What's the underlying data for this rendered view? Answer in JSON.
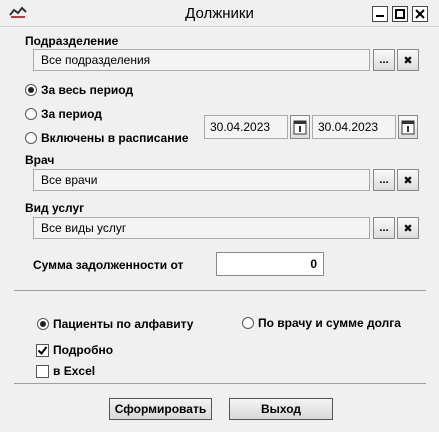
{
  "window": {
    "title": "Должники",
    "icon": "app-icon",
    "controls": [
      "minimize-icon",
      "maximize-icon",
      "close-icon"
    ]
  },
  "department": {
    "label": "Подразделение",
    "value": "Все подразделения",
    "select_label": "...",
    "clear_label": "✖"
  },
  "period": {
    "options": [
      "За весь период",
      "За период",
      "Включены в расписание"
    ],
    "selected": "За весь период",
    "date_from": "30.04.2023",
    "date_to": "30.04.2023",
    "calendar_icon": "calendar-icon"
  },
  "doctor": {
    "label": "Врач",
    "value": "Все врачи",
    "select_label": "...",
    "clear_label": "✖"
  },
  "service_type": {
    "label": "Вид услуг",
    "value": "Все виды услуг",
    "select_label": "...",
    "clear_label": "✖"
  },
  "debt": {
    "label": "Сумма задолженности от",
    "value": "0"
  },
  "sort": {
    "options": [
      "Пациенты по алфавиту",
      "По врачу и сумме долга"
    ],
    "selected": "Пациенты по алфавиту"
  },
  "options": {
    "detailed_label": "Подробно",
    "detailed_checked": true,
    "excel_label": "в Excel",
    "excel_checked": false
  },
  "buttons": {
    "generate": "Сформировать",
    "exit": "Выход"
  }
}
